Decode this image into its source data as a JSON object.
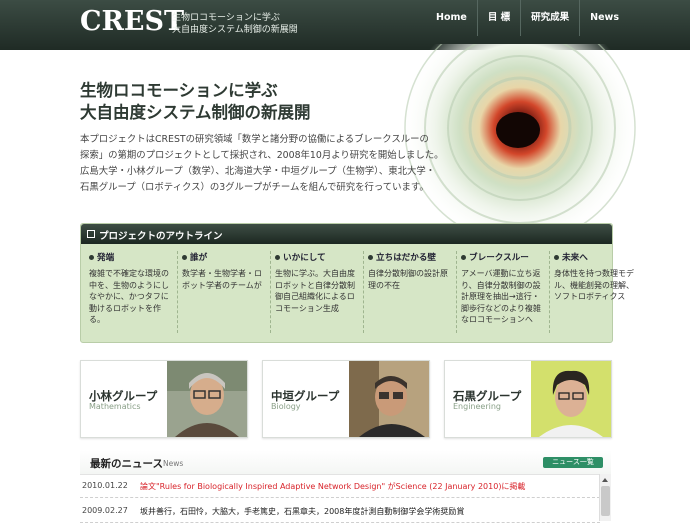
{
  "header": {
    "logo": "CREST",
    "subtitle_line1": "生物ロコモーションに学ぶ",
    "subtitle_line2": "大自由度システム制御の新展開",
    "nav": [
      {
        "label": "Home"
      },
      {
        "label": "目 標"
      },
      {
        "label": "研究成果"
      },
      {
        "label": "News"
      }
    ]
  },
  "hero": {
    "title_line1": "生物ロコモーションに学ぶ",
    "title_line2": "大自由度システム制御の新展開",
    "intro_line1": "本プロジェクトはCRESTの研究領域「数学と諸分野の協働によるブレークスルーの",
    "intro_line2": "探索」の第期のプロジェクトとして採択され、2008年10月より研究を開始しました。",
    "intro_line3": "広島大学・小林グループ（数学）、北海道大学・中垣グループ（生物学）、東北大学・",
    "intro_line4": "石黒グループ（ロボティクス）の3グループがチームを組んで研究を行っています。"
  },
  "outline": {
    "title": "プロジェクトのアウトライン",
    "columns": [
      {
        "title": "発端",
        "body": "複雑で不確定な環境の中を、生物のようにしなやかに、かつタフに動けるロボットを作る。"
      },
      {
        "title": "誰が",
        "body": "数学者・生物学者・ロボット学者のチームが"
      },
      {
        "title": "いかにして",
        "body": "生物に学ぶ。大自由度ロボットと自律分散制御自己組織化によるロコモーション生成"
      },
      {
        "title": "立ちはだかる壁",
        "body": "自律分散制御の設計原理の不在"
      },
      {
        "title": "ブレークスルー",
        "body": "アメーバ運動に立ち返り、自律分散制御の設計原理を抽出→這行・脚歩行などのより複雑なロコモーションへ"
      },
      {
        "title": "未来へ",
        "body": "身体性を持つ数理モデル、機能創発の理解、ソフトロボティクス"
      }
    ]
  },
  "groups": [
    {
      "name": "小林グループ",
      "field": "Mathematics"
    },
    {
      "name": "中垣グループ",
      "field": "Biology"
    },
    {
      "name": "石黒グループ",
      "field": "Engineering"
    }
  ],
  "news": {
    "title": "最新のニュース",
    "title_en": "News",
    "all_label": "ニュース一覧",
    "items": [
      {
        "date": "2010.01.22",
        "text": "論文\"Rules for Biologically Inspired Adaptive Network Design\" がScience (22 January 2010)に掲載"
      },
      {
        "date": "2009.02.27",
        "text": "坂井善行，石田怜，大脇大，手老篤史，石黒章夫，2008年度計測自動制御学会学術奨励賞"
      }
    ]
  },
  "colors": {
    "header_dark": "#1f2b25",
    "outline_bg": "#d6e6c6",
    "news_red": "#d8232a",
    "accent_green": "#2e8f66"
  }
}
